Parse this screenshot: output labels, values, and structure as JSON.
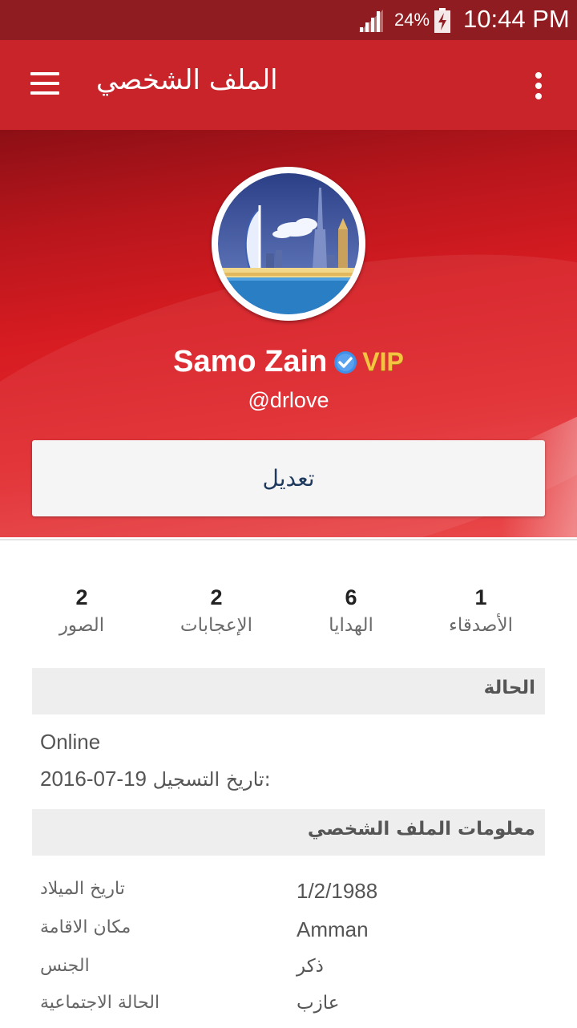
{
  "status_bar": {
    "battery_percent": "24%",
    "time": "10:44 PM"
  },
  "app_bar": {
    "title": "الملف الشخصي"
  },
  "profile": {
    "name": "Samo Zain",
    "badge": "VIP",
    "handle": "@drlove",
    "edit_label": "تعديل"
  },
  "stats": [
    {
      "count": "1",
      "label": "الأصدقاء"
    },
    {
      "count": "6",
      "label": "الهدايا"
    },
    {
      "count": "2",
      "label": "الإعجابات"
    },
    {
      "count": "2",
      "label": "الصور"
    }
  ],
  "status_section": {
    "title": "الحالة",
    "status": "Online",
    "registration_label": "تاريخ التسجيل:",
    "registration_date": "2016-07-19"
  },
  "info_section": {
    "title": "معلومات الملف الشخصي",
    "rows": [
      {
        "label": "تاريخ الميلاد",
        "value": "1/2/1988"
      },
      {
        "label": "مكان الاقامة",
        "value": "Amman"
      },
      {
        "label": "الجنس",
        "value": "ذكر"
      },
      {
        "label": "الحالة الاجتماعية",
        "value": "عازب"
      }
    ]
  },
  "colors": {
    "primary": "#c8242a",
    "status_bar": "#8f1c20",
    "vip_gold": "#f5c542",
    "verified_blue": "#3d8fe8"
  },
  "icons": [
    "signal-icon",
    "battery-charging-icon",
    "menu-icon",
    "overflow-menu-icon",
    "verified-icon"
  ]
}
